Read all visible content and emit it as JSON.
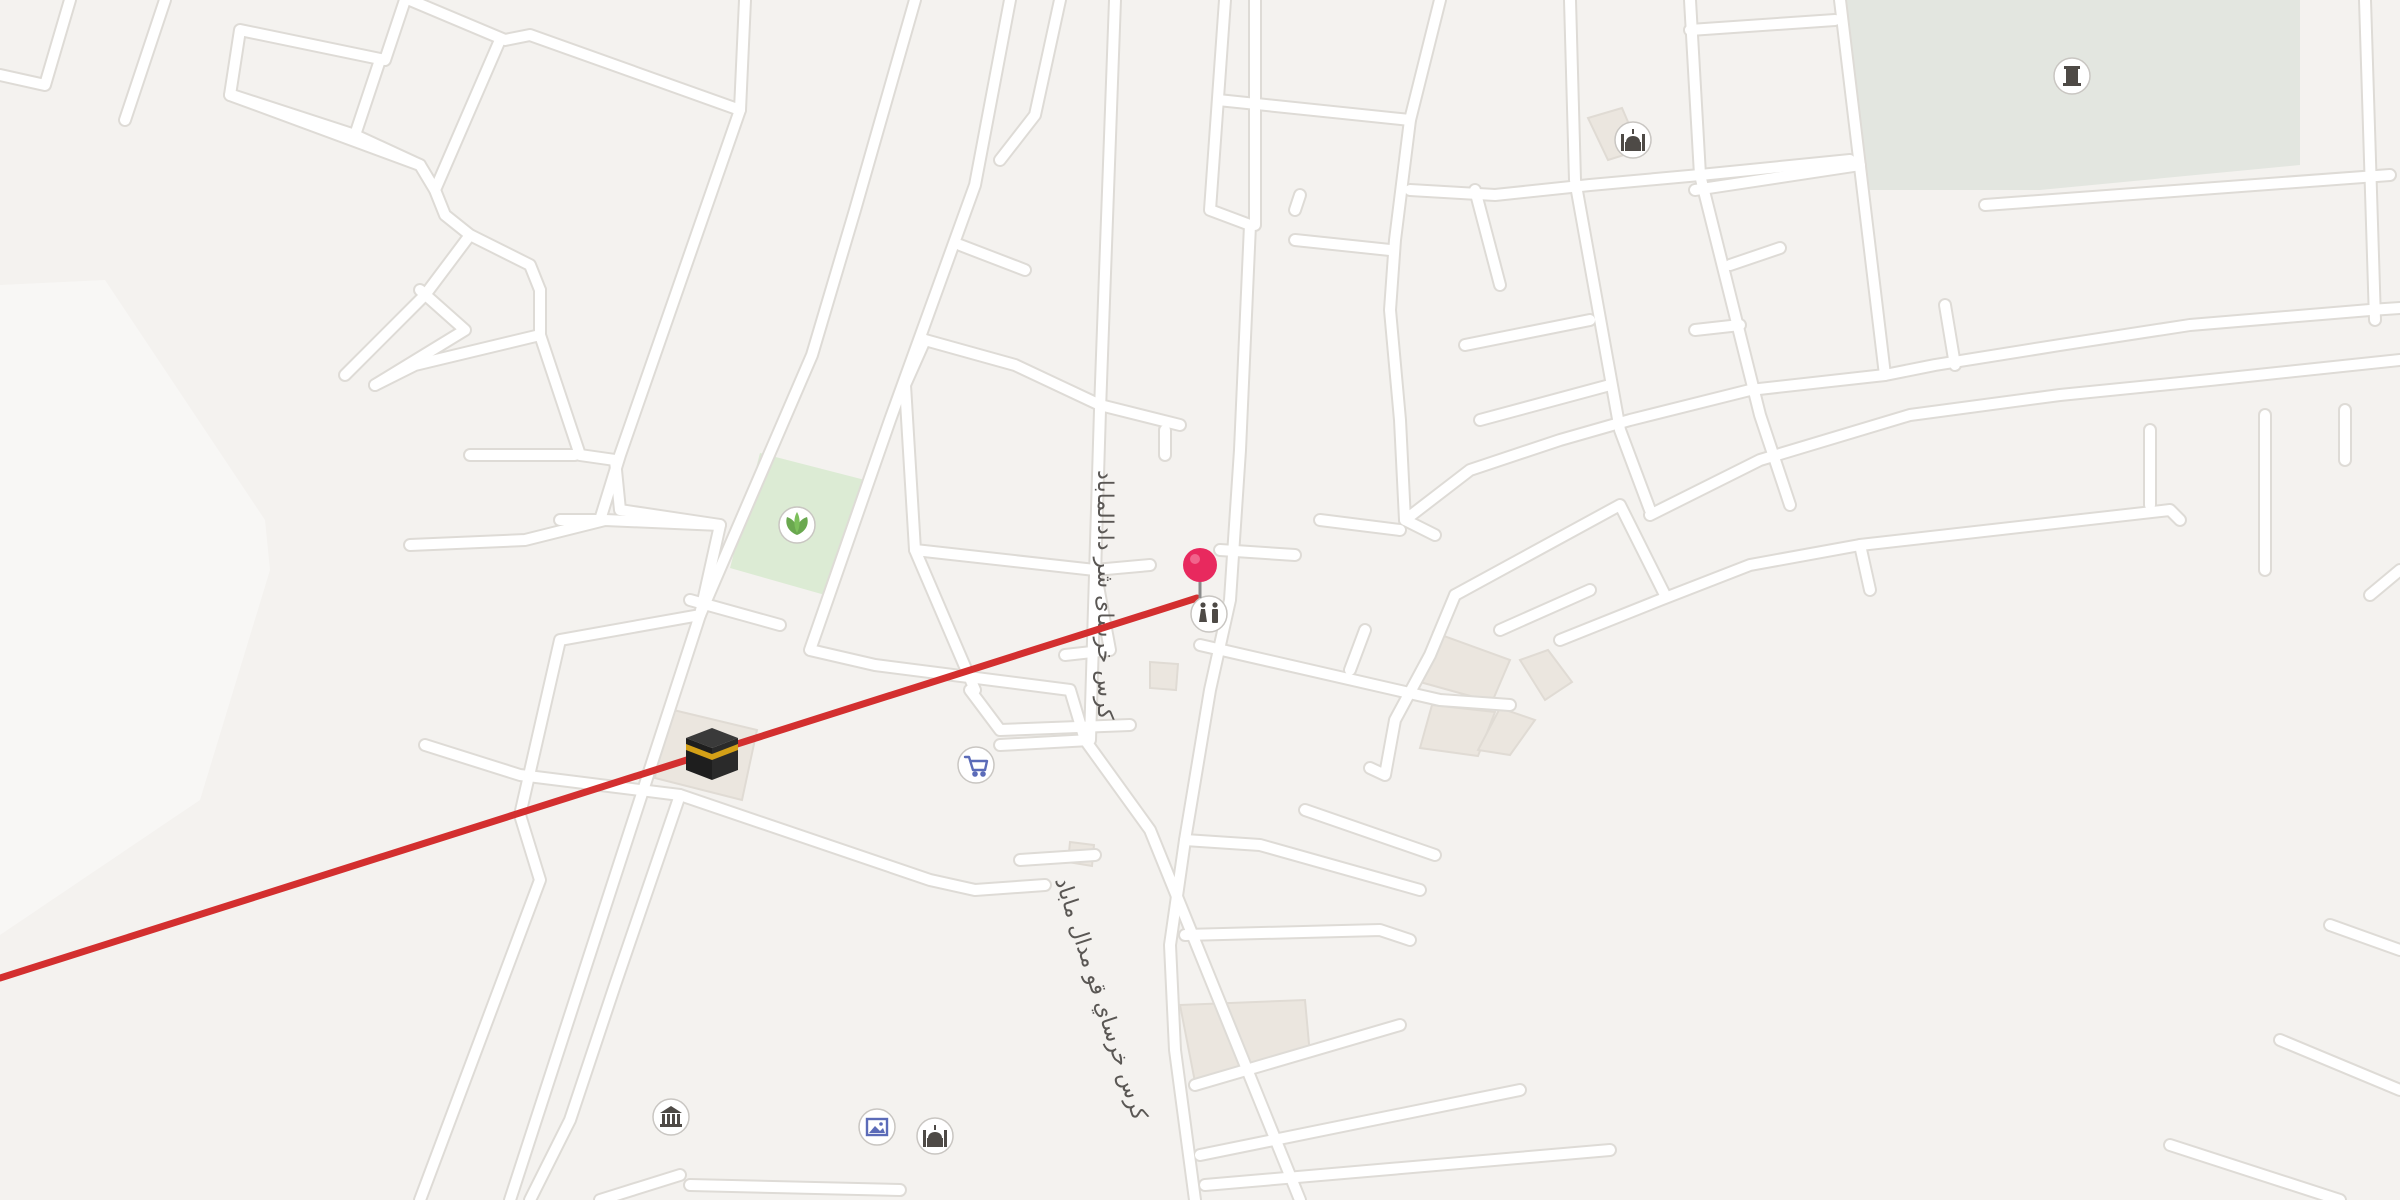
{
  "map": {
    "streets": [
      {
        "id": "street-upper",
        "name": "کرس خرسای شر دادالماباد"
      },
      {
        "id": "street-lower",
        "name": "کرس خرساي قو مدال ماباد"
      }
    ],
    "pois": [
      {
        "id": "kaaba",
        "icon": "kaaba-icon"
      },
      {
        "id": "park",
        "icon": "plant-icon"
      },
      {
        "id": "shopping",
        "icon": "shopping-cart-icon"
      },
      {
        "id": "restroom",
        "icon": "restroom-icon"
      },
      {
        "id": "mosque-top",
        "icon": "mosque-icon"
      },
      {
        "id": "monument",
        "icon": "monument-icon"
      },
      {
        "id": "museum",
        "icon": "museum-icon"
      },
      {
        "id": "gallery",
        "icon": "picture-icon"
      },
      {
        "id": "mosque-bottom",
        "icon": "mosque-icon"
      }
    ],
    "pin": {
      "color": "#e8295e",
      "icon": "location-pin-icon"
    },
    "route": {
      "color": "#d32f2f"
    },
    "colors": {
      "background": "#f4f2ef",
      "road": "#ffffff",
      "park": "#dcebd4",
      "cemetery": "#e3e6e0",
      "building": "#ebe6df",
      "poi_icon": "#4e4a46",
      "shopping_icon": "#5b6bb8"
    }
  }
}
